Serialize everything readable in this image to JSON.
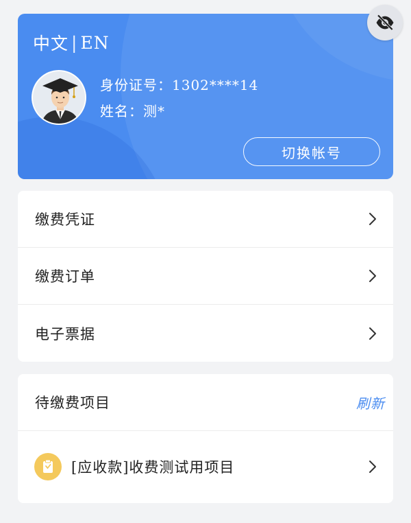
{
  "profile": {
    "lang_zh": "中文",
    "lang_sep": "|",
    "lang_en": "EN",
    "id_label": "身份证号：",
    "id_value": "1302****14",
    "name_label": "姓名：",
    "name_value": "测*",
    "switch_account": "切换帐号",
    "eye_icon": "eye-off-icon",
    "avatar_icon": "graduate-avatar"
  },
  "menu": {
    "items": [
      {
        "label": "缴费凭证"
      },
      {
        "label": "缴费订单"
      },
      {
        "label": "电子票据"
      }
    ]
  },
  "pending": {
    "title": "待缴费项目",
    "refresh": "刷新",
    "items": [
      {
        "label": "[应收款]收费测试用项目",
        "icon": "clipboard-icon"
      }
    ]
  },
  "colors": {
    "accent": "#4a8cf0",
    "icon_yellow": "#f4c95c",
    "background": "#f2f3f5"
  }
}
